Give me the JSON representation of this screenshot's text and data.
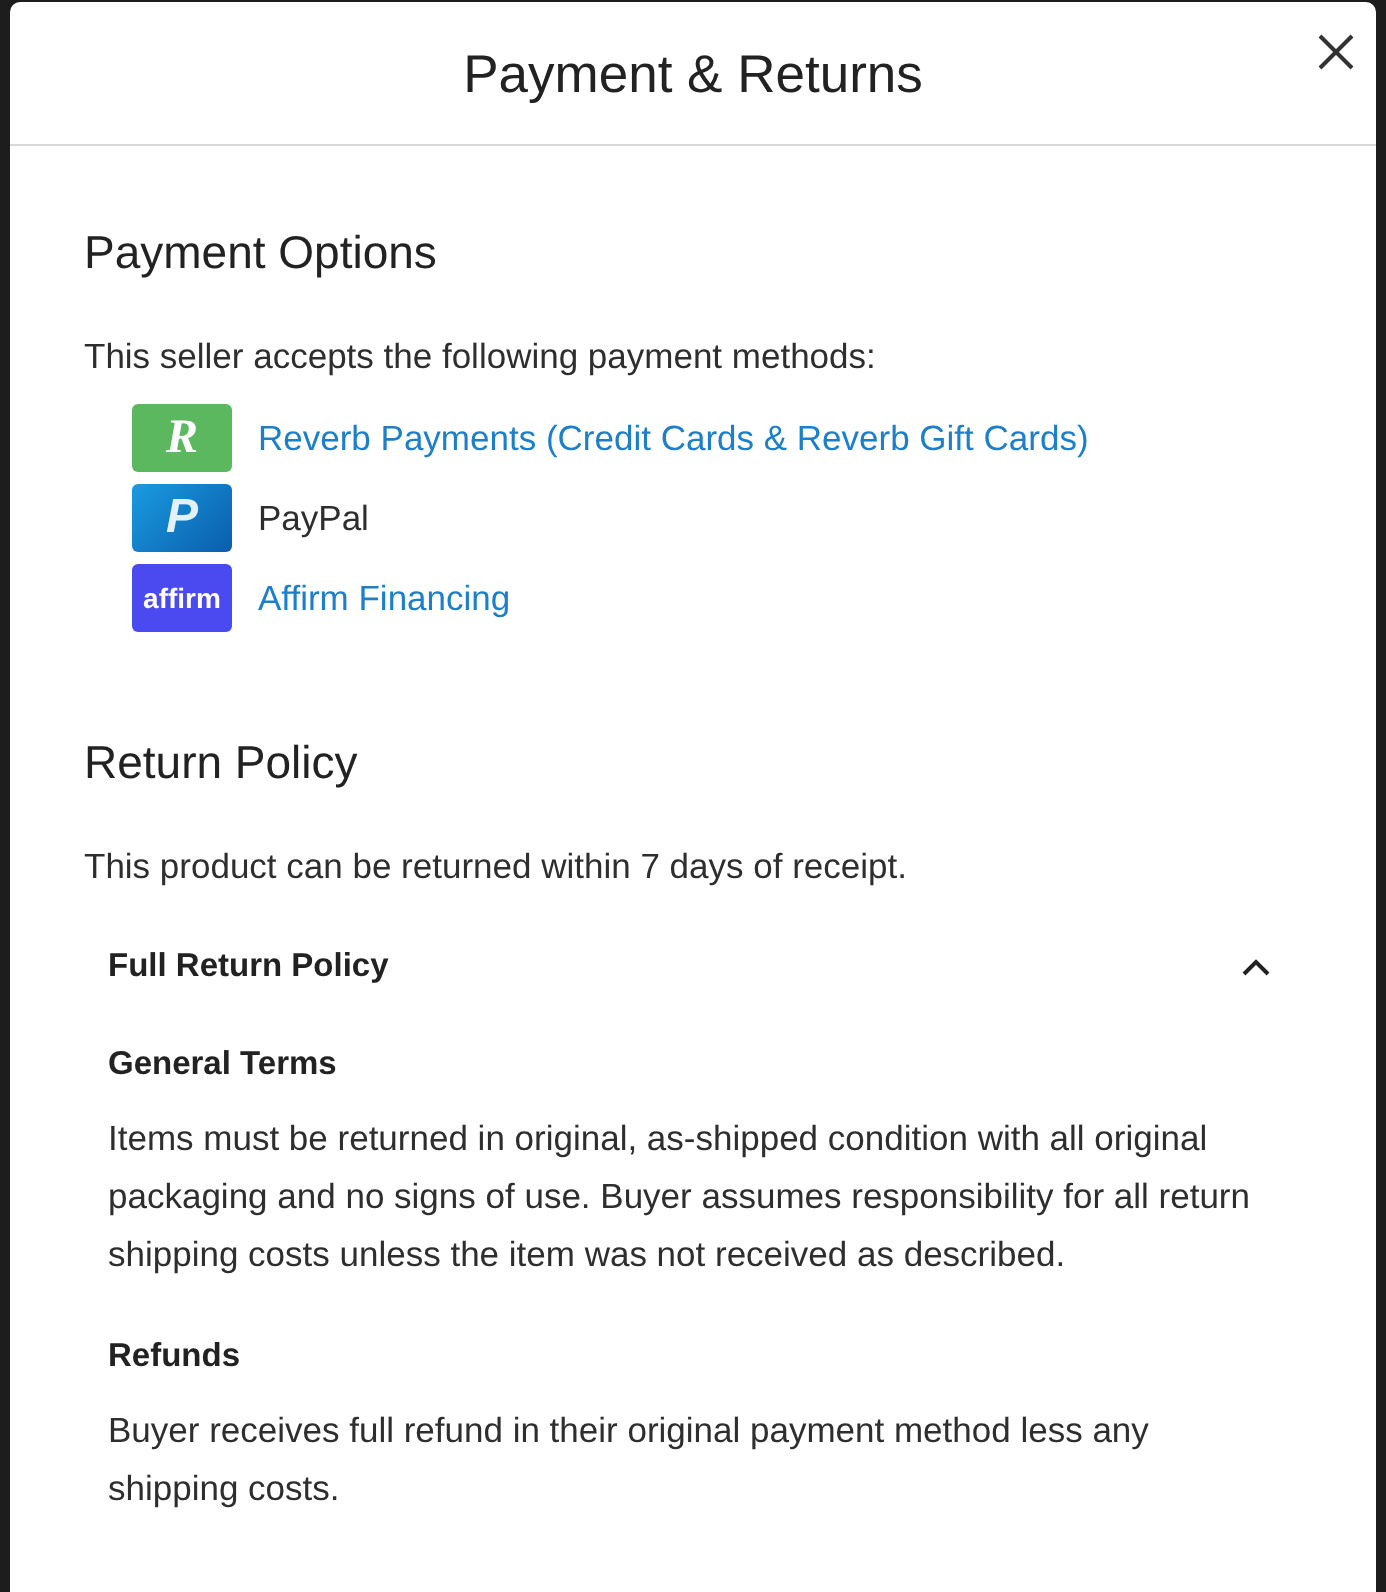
{
  "dialog": {
    "title": "Payment & Returns"
  },
  "payment_options": {
    "heading": "Payment Options",
    "intro": "This seller accepts the following payment methods:",
    "methods": [
      {
        "kind": "reverb",
        "badge_text": "R",
        "label": "Reverb Payments (Credit Cards & Reverb Gift Cards)",
        "link": true
      },
      {
        "kind": "paypal",
        "badge_text": "P",
        "label": "PayPal",
        "link": false
      },
      {
        "kind": "affirm",
        "badge_text": "affirm",
        "label": "Affirm Financing",
        "link": true
      }
    ]
  },
  "return_policy": {
    "heading": "Return Policy",
    "summary": "This product can be returned within 7 days of receipt.",
    "details": {
      "title": "Full Return Policy",
      "expanded": true,
      "sections": [
        {
          "heading": "General Terms",
          "text": "Items must be returned in original, as-shipped condition with all original packaging and no signs of use. Buyer assumes responsibility for all return shipping costs unless the item was not received as described."
        },
        {
          "heading": "Refunds",
          "text": "Buyer receives full refund in their original payment method less any shipping costs."
        }
      ]
    }
  }
}
